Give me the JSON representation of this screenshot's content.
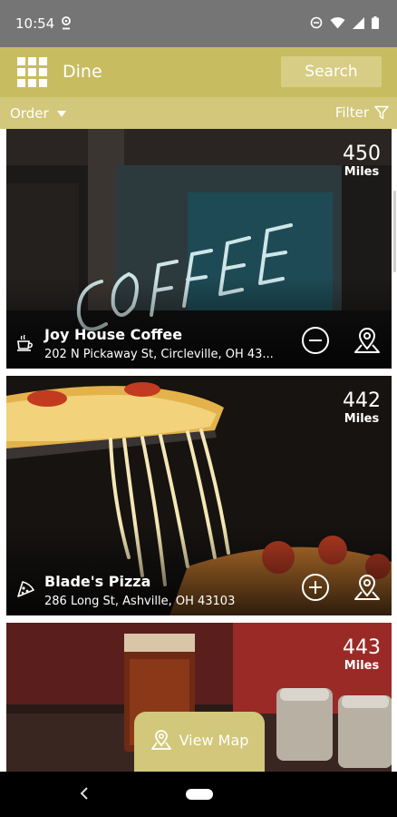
{
  "status_bar": {
    "time": "10:54"
  },
  "app_bar": {
    "title": "Dine",
    "search_label": "Search"
  },
  "sub_bar": {
    "order_label": "Order",
    "filter_label": "Filter"
  },
  "restaurants": [
    {
      "name": "Joy House Coffee",
      "address": "202 N Pickaway St, Circleville, OH 43...",
      "distance": "450",
      "unit": "Miles",
      "category_icon": "coffee-cup-icon",
      "action_icon": "minus-circle-icon"
    },
    {
      "name": "Blade's Pizza",
      "address": "286 Long St, Ashville, OH 43103",
      "distance": "442",
      "unit": "Miles",
      "category_icon": "pizza-slice-icon",
      "action_icon": "plus-circle-icon"
    },
    {
      "distance": "443",
      "unit": "Miles"
    }
  ],
  "view_map": {
    "label": "View Map"
  },
  "colors": {
    "brand": "#c8bc61",
    "status_bar": "#757575"
  }
}
